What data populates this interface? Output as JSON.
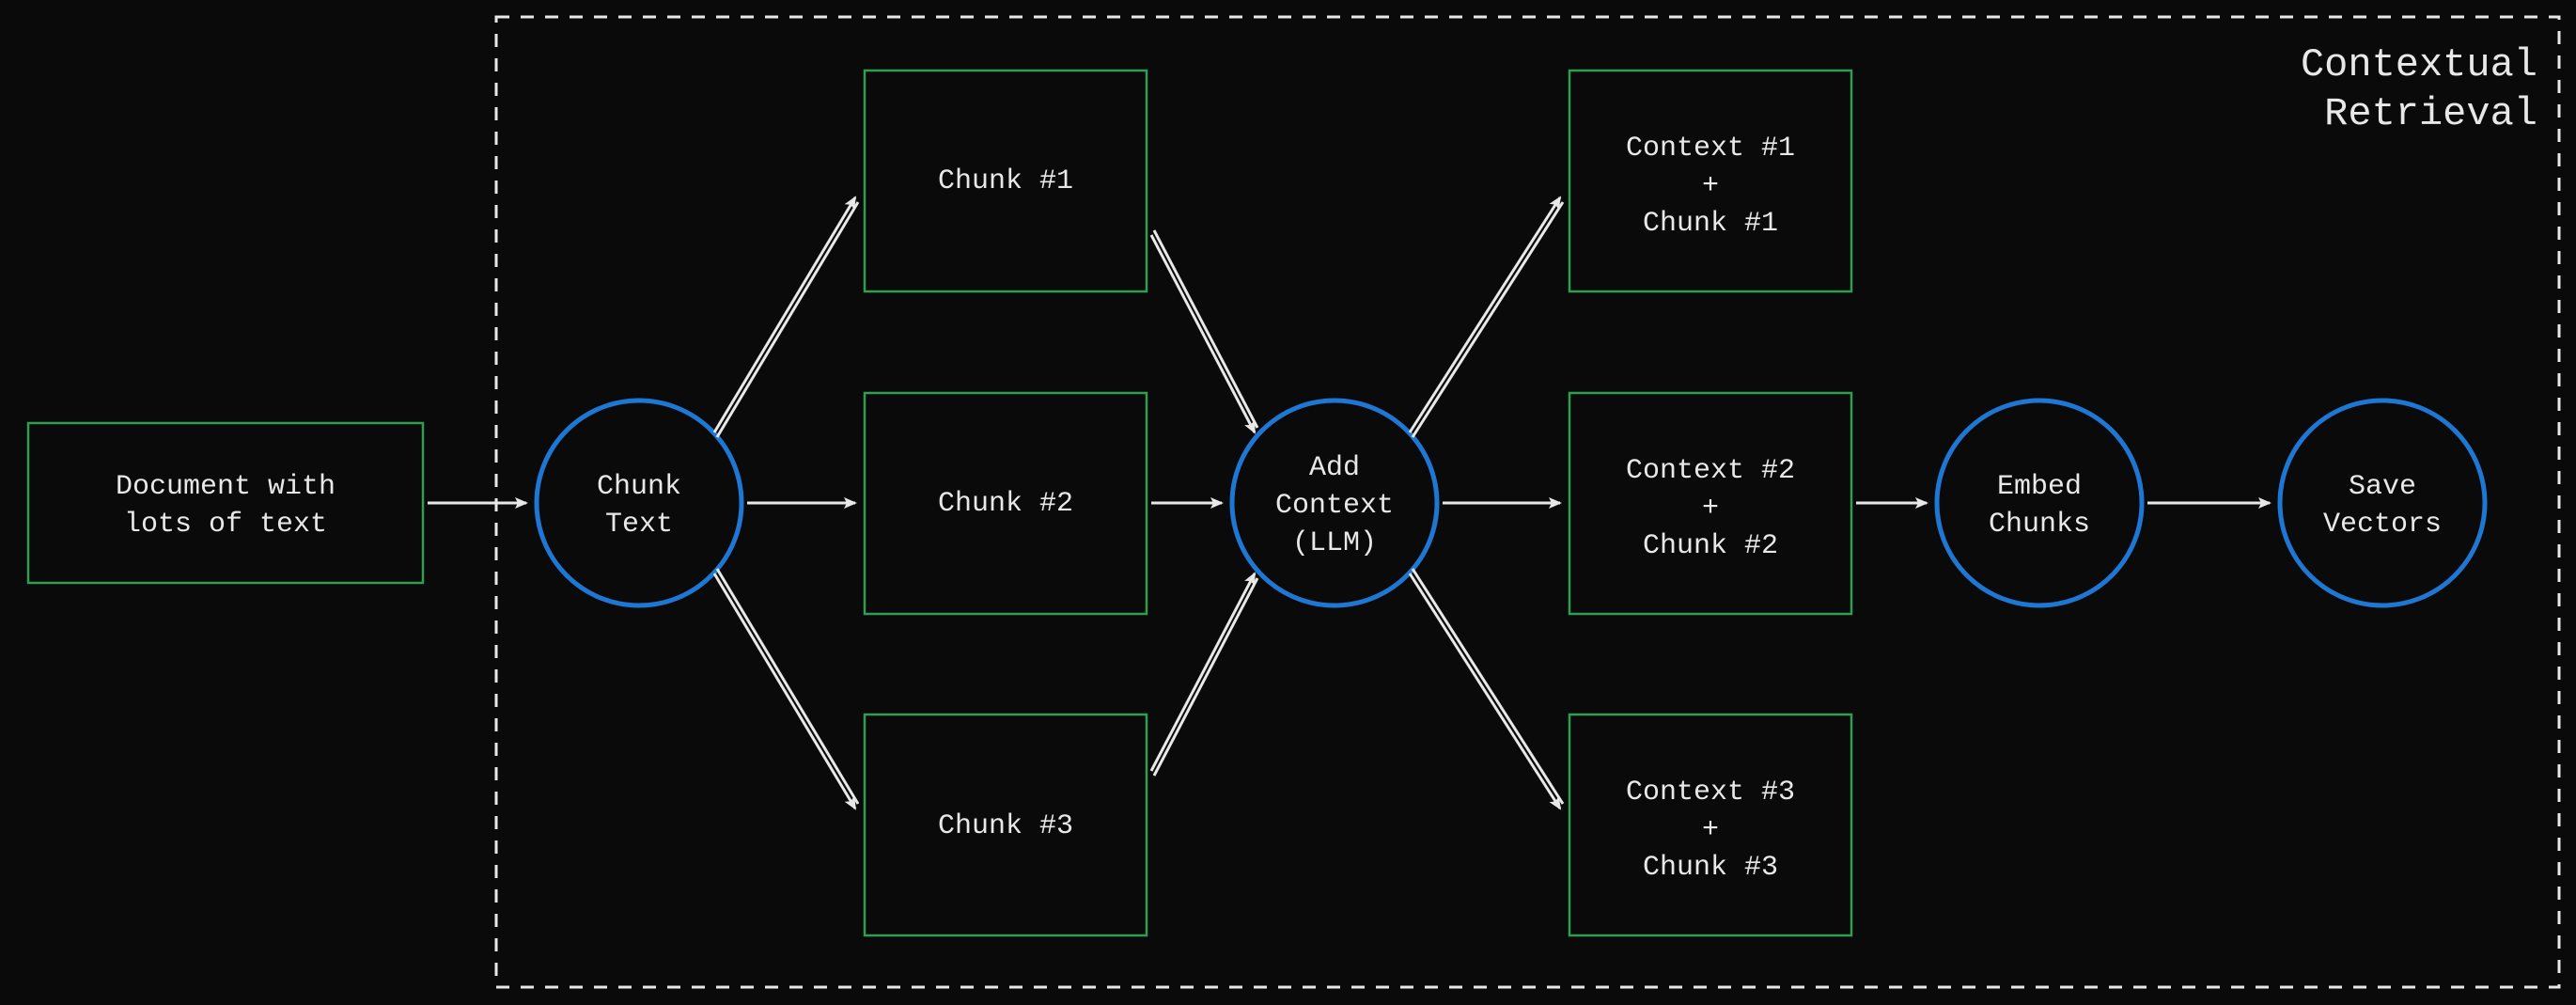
{
  "title_line1": "Contextual",
  "title_line2": "Retrieval",
  "doc_line1": "Document with",
  "doc_line2": "lots of text",
  "chunk_text_line1": "Chunk",
  "chunk_text_line2": "Text",
  "chunks": {
    "c1": "Chunk #1",
    "c2": "Chunk #2",
    "c3": "Chunk #3"
  },
  "add_ctx_line1": "Add",
  "add_ctx_line2": "Context",
  "add_ctx_line3": "(LLM)",
  "ctx_chunks": {
    "a1": "Context #1",
    "a2": "Context #2",
    "a3": "Context #3",
    "plus": "+",
    "b1": "Chunk #1",
    "b2": "Chunk #2",
    "b3": "Chunk #3"
  },
  "embed_line1": "Embed",
  "embed_line2": "Chunks",
  "save_line1": "Save",
  "save_line2": "Vectors"
}
